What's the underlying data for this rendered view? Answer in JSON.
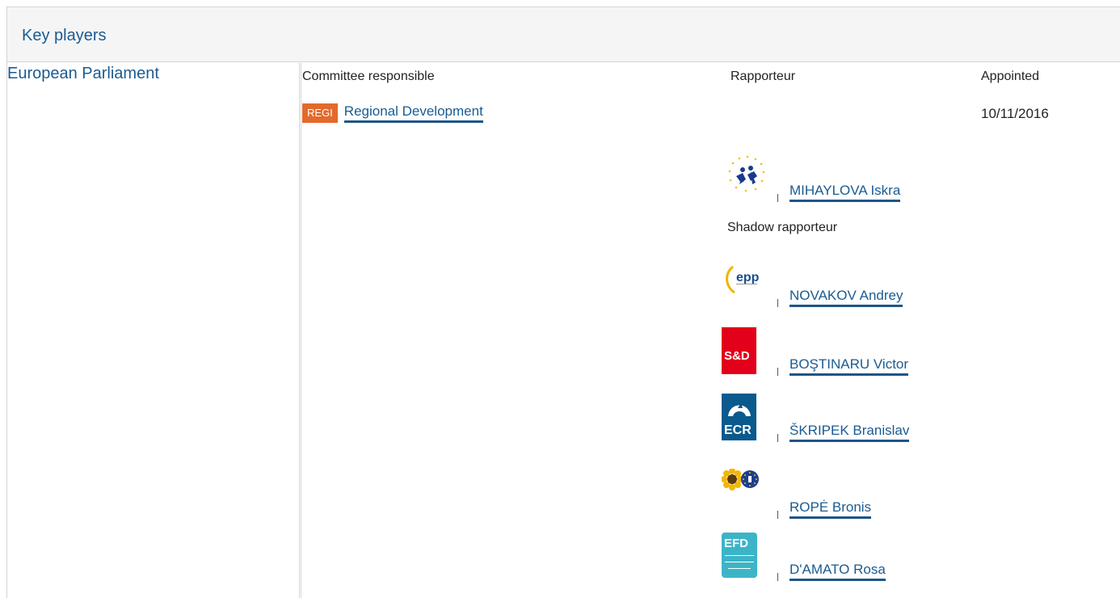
{
  "section": {
    "title": "Key players"
  },
  "institution": {
    "name": "European Parliament"
  },
  "headers": {
    "committee": "Committee responsible",
    "rapporteur": "Rapporteur",
    "appointed": "Appointed"
  },
  "committee": {
    "code": "REGI",
    "name": "Regional Development",
    "appointed": "10/11/2016",
    "badge_color": "#e36a2b"
  },
  "rapporteur": {
    "name": "MIHAYLOVA Iskra",
    "group_logo": "alde-logo-icon"
  },
  "shadow": {
    "label": "Shadow rapporteur",
    "members": [
      {
        "name": "NOVAKOV Andrey",
        "group_logo": "epp-logo-icon",
        "logo_text": "epp"
      },
      {
        "name": "BOŞTINARU Victor",
        "group_logo": "sd-logo-icon",
        "logo_text": "S&D"
      },
      {
        "name": "ŠKRIPEK Branislav",
        "group_logo": "ecr-logo-icon",
        "logo_text": "ECR"
      },
      {
        "name": "ROPĖ Bronis",
        "group_logo": "greens-efa-logo-icon"
      },
      {
        "name": "D'AMATO Rosa",
        "group_logo": "efdd-logo-icon",
        "logo_text": "EFD"
      }
    ]
  },
  "colors": {
    "link": "#1a5b92",
    "underline": "#1f5489",
    "sd_red": "#e2001a",
    "ecr_blue": "#0a5a8e",
    "efdd_teal": "#3cb4c8"
  }
}
